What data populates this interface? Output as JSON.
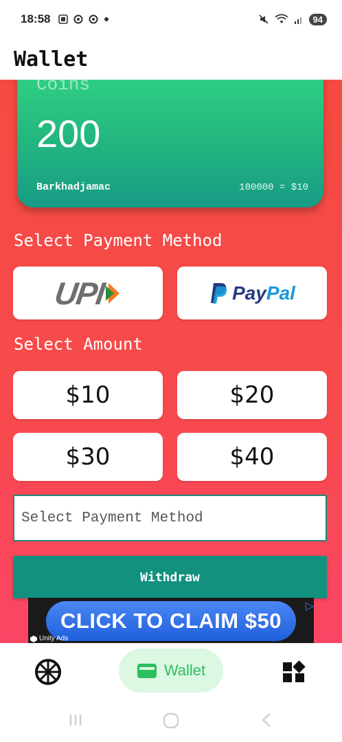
{
  "status_bar": {
    "time": "18:58",
    "battery": "94",
    "icons": [
      "screenshot-icon",
      "app-icon",
      "app-icon",
      "dot-icon",
      "mute-icon",
      "wifi-icon",
      "signal-icon",
      "battery-icon"
    ]
  },
  "app_bar": {
    "title": "Wallet"
  },
  "coin_card": {
    "label": "Coins",
    "value": "200",
    "username": "Barkhadjamac",
    "rate": "100000 = $10"
  },
  "payment": {
    "section_title": "Select Payment Method",
    "methods": [
      {
        "name": "UPI"
      },
      {
        "name_part1": "Pay",
        "name_part2": "Pal"
      }
    ]
  },
  "amount": {
    "section_title": "Select Amount",
    "options": [
      "$10",
      "$20",
      "$30",
      "$40"
    ]
  },
  "method_field": {
    "placeholder": "Select Payment Method"
  },
  "withdraw": {
    "label": "Withdraw"
  },
  "ad": {
    "text": "CLICK TO CLAIM $50",
    "badge": "Unity Ads"
  },
  "bottom_nav": {
    "items": [
      {
        "icon": "wheel-icon",
        "label": ""
      },
      {
        "icon": "wallet-icon",
        "label": "Wallet"
      },
      {
        "icon": "apps-grid-icon",
        "label": ""
      }
    ]
  },
  "colors": {
    "accent_green": "#2bbf5d",
    "card_gradient_top": "#32d383",
    "card_gradient_bottom": "#179b85",
    "background_red": "#f84a4d",
    "withdraw_teal": "#13917f"
  }
}
